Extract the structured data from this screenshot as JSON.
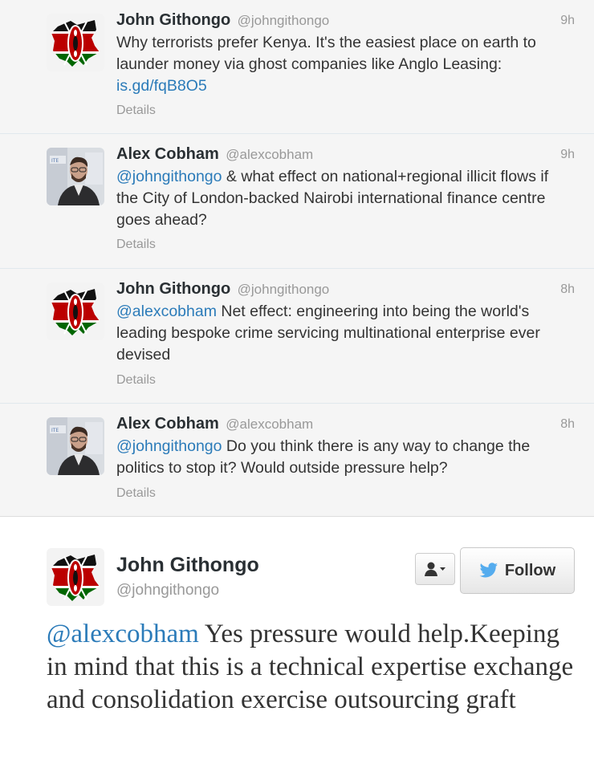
{
  "tweets": [
    {
      "fullname": "John Githongo",
      "handle": "@johngithongo",
      "time": "9h",
      "text": "Why terrorists prefer Kenya. It's the easiest place on earth to launder money via ghost companies like Anglo Leasing: ",
      "link": "is.gd/fqB8O5",
      "details": "Details",
      "avatar_icon": "kenya-map-flag-avatar"
    },
    {
      "fullname": "Alex Cobham",
      "handle": "@alexcobham",
      "time": "9h",
      "mention": "@johngithongo",
      "text": " & what effect on national+regional illicit flows if the City of London-backed Nairobi international finance centre goes ahead?",
      "details": "Details",
      "avatar_icon": "alex-cobham-photo-avatar"
    },
    {
      "fullname": "John Githongo",
      "handle": "@johngithongo",
      "time": "8h",
      "mention": "@alexcobham",
      "text": " Net effect: engineering into being the world's leading bespoke crime servicing multinational enterprise ever devised",
      "details": "Details",
      "avatar_icon": "kenya-map-flag-avatar"
    },
    {
      "fullname": "Alex Cobham",
      "handle": "@alexcobham",
      "time": "8h",
      "mention": "@johngithongo",
      "text": " Do you think there is any way to change the politics to stop it? Would outside pressure help?",
      "details": "Details",
      "avatar_icon": "alex-cobham-photo-avatar"
    }
  ],
  "main_tweet": {
    "fullname": "John Githongo",
    "handle": "@johngithongo",
    "follow_label": "Follow",
    "mention": "@alexcobham",
    "text": " Yes pressure would help.Keeping in mind that this is a technical expertise exchange and consolidation exercise outsourcing graft"
  },
  "colors": {
    "link": "#2b7bb9",
    "twitter_bird": "#55acee",
    "thread_bg": "#f5f5f5"
  }
}
